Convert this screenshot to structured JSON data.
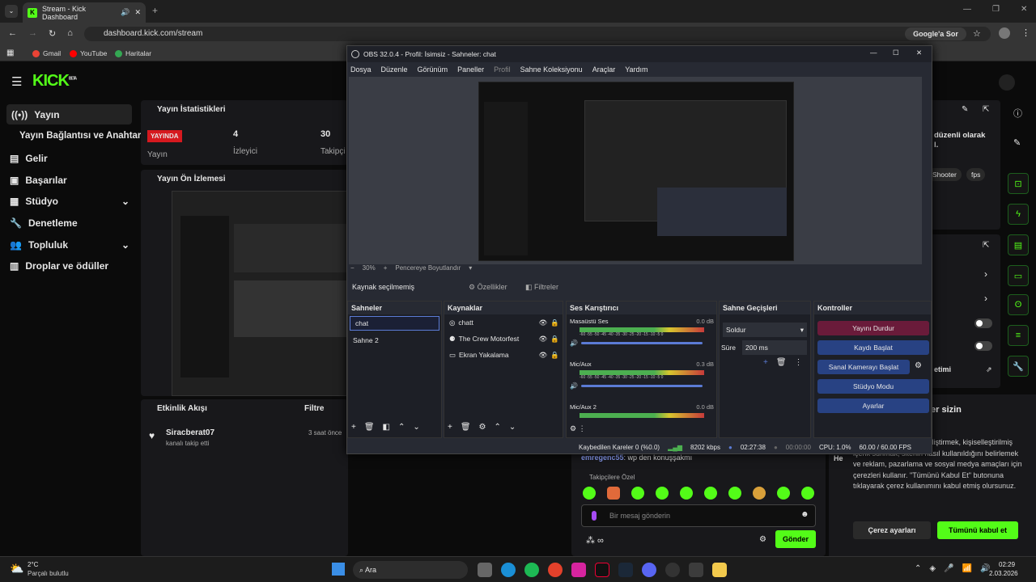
{
  "browser": {
    "tab_title": "Stream - Kick Dashboard",
    "url": "dashboard.kick.com/stream",
    "google_btn": "Google'a Sor",
    "bookmarks": [
      "Gmail",
      "YouTube",
      "Haritalar"
    ]
  },
  "kick": {
    "logo": "KICK",
    "logo_sup": "BETA",
    "sidebar": [
      {
        "label": "Yayın",
        "icon": "broadcast-icon"
      },
      {
        "label": "Yayın Bağlantısı ve Anahtarı",
        "icon": ""
      },
      {
        "label": "Gelir",
        "icon": "revenue-icon"
      },
      {
        "label": "Başarılar",
        "icon": "achievements-icon"
      },
      {
        "label": "Stüdyo",
        "icon": "studio-icon"
      },
      {
        "label": "Denetleme",
        "icon": "moderation-icon"
      },
      {
        "label": "Topluluk",
        "icon": "community-icon"
      },
      {
        "label": "Droplar ve ödüller",
        "icon": "drops-icon"
      }
    ],
    "stats": {
      "title": "Yayın İstatistikleri",
      "live_badge": "YAYINDA",
      "live_label": "Yayın",
      "viewers": "4",
      "viewers_label": "İzleyici",
      "followers": "30",
      "followers_label": "Takipçi"
    },
    "preview_title": "Yayın Ön İzlemesi",
    "activity": {
      "title": "Etkinlik Akışı",
      "filter": "Filtre",
      "user": "Siracberat07",
      "desc": "kanalı takip etti",
      "time": "3 saat önce"
    },
    "right_text": {
      "line1": "düzenli olarak",
      "line2": "l.",
      "tag1": "Shooter",
      "tag2": "fps",
      "etimi": "etimi",
      "heading": "er sizin"
    },
    "chat": {
      "user": "emregenc55",
      "msg": ": wp den konuşşakmı",
      "sub_label": "Takipçilere Özel",
      "placeholder": "Bir mesaj gönderin",
      "send": "Gönder"
    },
    "cookie": {
      "text": ", tarama deneyiminizi geliştirmek, kişiselleştirilmiş içerik sunmak, sitenin nasıl kullanıldığını belirlemek ve reklam, pazarlama ve sosyal medya amaçları için çerezleri kullanır. \"Tümünü Kabul Et\" butonuna tıklayarak çerez kullanımını kabul etmiş olursunuz.",
      "settings": "Çerez ayarları",
      "accept": "Tümünü kabul et",
      "he": "He"
    }
  },
  "obs": {
    "title": "OBS 32.0.4 - Profil: İsimsiz - Sahneler: chat",
    "menu": [
      "Dosya",
      "Düzenle",
      "Görünüm",
      "Paneller",
      "Profil",
      "Sahne Koleksiyonu",
      "Araçlar",
      "Yardım"
    ],
    "zoom": "30%",
    "fit": "Pencereye Boyutlandır",
    "no_source": "Kaynak seçilmemiş",
    "props": "Özellikler",
    "filters": "Filtreler",
    "scenes_title": "Sahneler",
    "scenes": [
      "chat",
      "Sahne 2"
    ],
    "sources_title": "Kaynaklar",
    "sources": [
      "chatt",
      "The Crew Motorfest",
      "Ekran Yakalama"
    ],
    "mixer_title": "Ses Karıştırıcı",
    "mixer": [
      {
        "name": "Masaüstü Ses",
        "db": "0.0 dB",
        "level": 0.85
      },
      {
        "name": "Mic/Aux",
        "db": "0.3 dB",
        "level": 0.55
      },
      {
        "name": "Mic/Aux 2",
        "db": "0.0 dB",
        "level": 0.4
      }
    ],
    "meter_scale": "-60 -55 -50 -45 -40 -35 -30 -25 -20 -15 -10 -5 0",
    "trans_title": "Sahne Geçişleri",
    "trans": "Soldur",
    "duration_label": "Süre",
    "duration": "200 ms",
    "controls_title": "Kontroller",
    "controls": [
      "Yayını Durdur",
      "Kaydı Başlat",
      "Sanal Kamerayı Başlat",
      "Stüdyo Modu",
      "Ayarlar"
    ],
    "status": {
      "dropped": "Kaybedilen Kareler 0 (%0.0)",
      "kbps": "8202 kbps",
      "time": "02:27:38",
      "rec": "00:00:00",
      "cpu": "CPU: 1.0%",
      "fps": "60.00 / 60.00 FPS"
    }
  },
  "taskbar": {
    "weather": "2°C",
    "weather_desc": "Parçalı bulutlu",
    "search": "Ara",
    "time": "02:29",
    "date": "2.03.2026"
  }
}
